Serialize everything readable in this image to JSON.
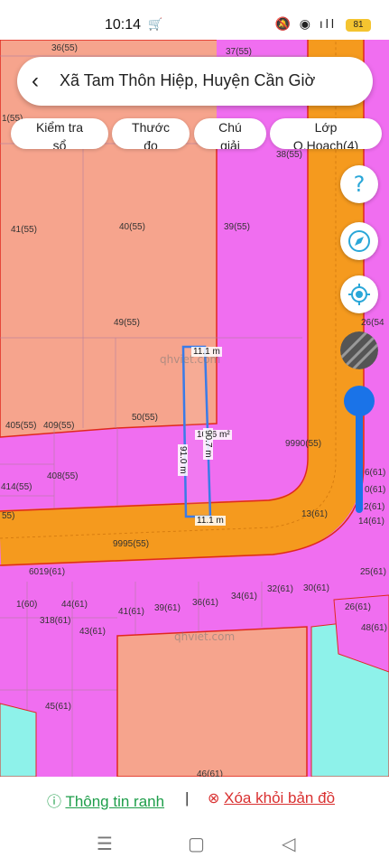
{
  "status_bar": {
    "time": "10:14",
    "cart_icon": "shopping-cart-icon",
    "icons": "🔕 ◉ ıll",
    "battery": "81"
  },
  "header": {
    "back_icon": "chevron-left-icon",
    "title": "Xã Tam Thôn Hiệp, Huyện Cần Giờ"
  },
  "toolbar": {
    "check_line1": "Kiểm tra",
    "check_line2": "sổ",
    "measure_line1": "Thước",
    "measure_line2": "đo",
    "legend_line1": "Chú",
    "legend_line2": "giải",
    "layer_line1": "Lớp",
    "layer_line2": "Q.Hoạch(4)"
  },
  "map": {
    "lots": {
      "l36_55": "36(55)",
      "l37_55": "37(55)",
      "l1_55": "1(55)",
      "l38_55": "38(55)",
      "l41_55": "41(55)",
      "l40_55": "40(55)",
      "l39_55": "39(55)",
      "l26_54": "26(54",
      "l49_55": "49(55)",
      "l50_55": "50(55)",
      "l405_55": "405(55)",
      "l409_55": "409(55)",
      "l9990_55": "9990(55)",
      "l408_55": "408(55)",
      "l414_55": "414(55)",
      "l55": "55)",
      "l13_61": "13(61)",
      "l14_61": "14(61)",
      "l2_61": "2(61)",
      "l6_61": "6(61)",
      "l10_61": "0(61)",
      "l9995_55": "9995(55)",
      "l6019_61": "6019(61)",
      "l25_61": "25(61)",
      "l1_60": "1(60)",
      "l44_61": "44(61)",
      "l41_61": "41(61)",
      "l39_61": "39(61)",
      "l36_61": "36(61)",
      "l34_61": "34(61)",
      "l32_61": "32(61)",
      "l30_61": "30(61)",
      "l26_61": "26(61)",
      "l48_61": "48(61)",
      "l318_61": "318(61)",
      "l43_61": "43(61)",
      "l45_61": "45(61)",
      "l46_61": "46(61)"
    },
    "watermark": "qhviet.com",
    "measure_top": "11.1 m",
    "measure_bottom": "11.1 m",
    "measure_left": "91.0 m",
    "measure_right": "90.7 m",
    "area": "1006 m²",
    "colors": {
      "residential": "#f06ef0",
      "commercial": "#f6a48d",
      "road": "#f59a1e",
      "water": "#8ef2ea",
      "boundary": "#e0281e",
      "selection": "#3a7be8"
    }
  },
  "fab": {
    "help_icon": "help-icon",
    "compass_icon": "compass-icon",
    "locate_icon": "locate-icon",
    "layer_icon": "satellite-layer-icon",
    "opacity_level": 0.85
  },
  "bottom": {
    "info_icon": "info-icon",
    "info_label": "Thông tin ranh",
    "separator": "|",
    "remove_icon": "close-circle-icon",
    "remove_label": "Xóa khỏi bản đồ"
  },
  "nav": {
    "menu_icon": "menu-icon",
    "home_icon": "home-icon",
    "back_icon": "back-icon"
  }
}
